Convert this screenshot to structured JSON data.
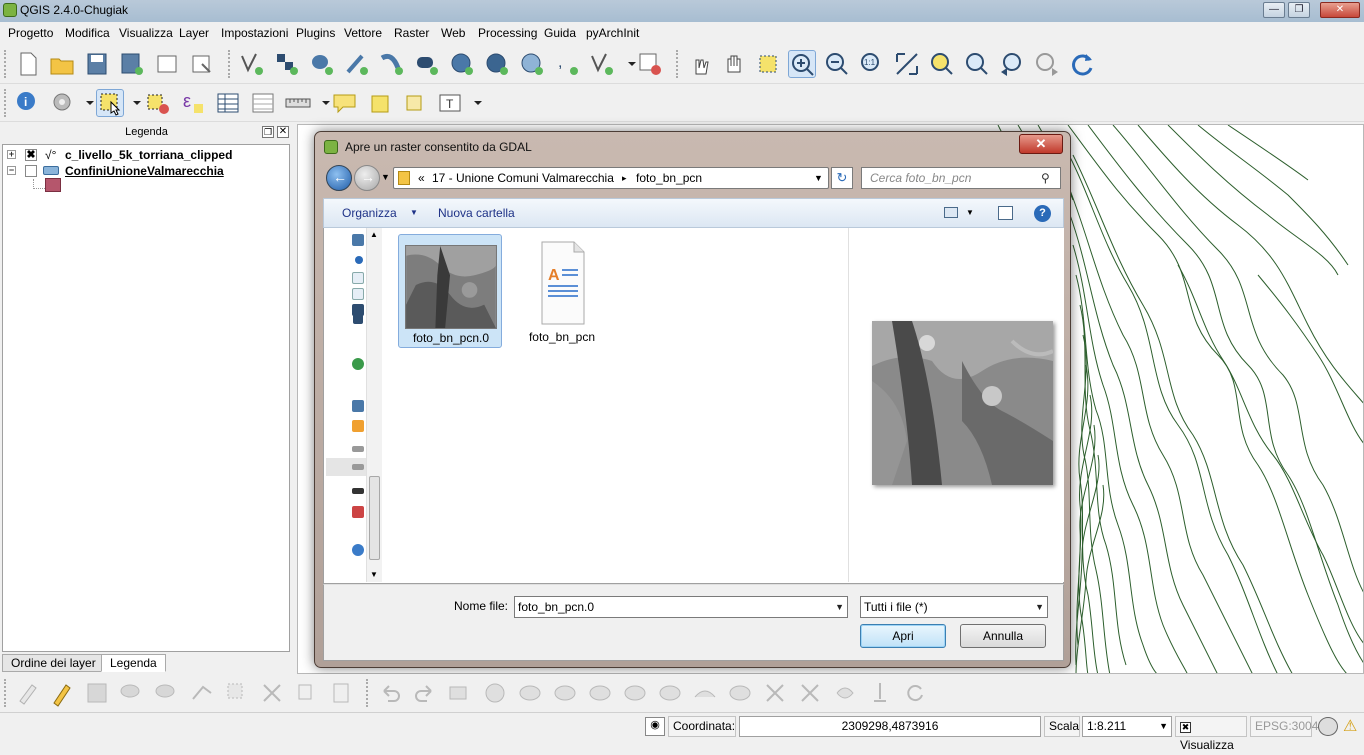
{
  "window": {
    "title": "QGIS 2.4.0-Chugiak",
    "min_label": "—",
    "max_label": "❐",
    "close_label": "✕"
  },
  "menu": [
    "Progetto",
    "Modifica",
    "Visualizza",
    "Layer",
    "Impostazioni",
    "Plugins",
    "Vettore",
    "Raster",
    "Web",
    "Processing",
    "Guida",
    "pyArchInit"
  ],
  "legend": {
    "header": "Legenda",
    "layers": [
      {
        "name": "c_livello_5k_torriana_clipped",
        "checked": true
      },
      {
        "name": "ConfiniUnioneValmarecchia",
        "checked": false
      }
    ],
    "symbol_color": "#b5566c",
    "tabs": [
      "Ordine dei layer",
      "Legenda"
    ]
  },
  "dialog": {
    "title": "Apre un raster consentito da GDAL",
    "close_label": "✕",
    "breadcrumb": {
      "prefix": "«",
      "folder": "17 - Unione Comuni Valmarecchia",
      "sep": "▸",
      "current": "foto_bn_pcn"
    },
    "search_placeholder": "Cerca foto_bn_pcn",
    "cmd": {
      "organize": "Organizza",
      "new_folder": "Nuova cartella"
    },
    "files": [
      {
        "name": "foto_bn_pcn.0",
        "selected": true
      },
      {
        "name": "foto_bn_pcn",
        "selected": false
      }
    ],
    "filename_label": "Nome file:",
    "filename_value": "foto_bn_pcn.0",
    "filetype_value": "Tutti i file (*)",
    "open_label": "Apri",
    "cancel_label": "Annulla"
  },
  "status": {
    "coord_label": "Coordinata:",
    "coord_value": "2309298,4873916",
    "scale_label": "Scala",
    "scale_value": "1:8.211",
    "render_label": "Visualizza",
    "crs": "EPSG:3004"
  },
  "colors": {
    "contour": "#2c5e2c",
    "accent": "#3c7fb1"
  }
}
